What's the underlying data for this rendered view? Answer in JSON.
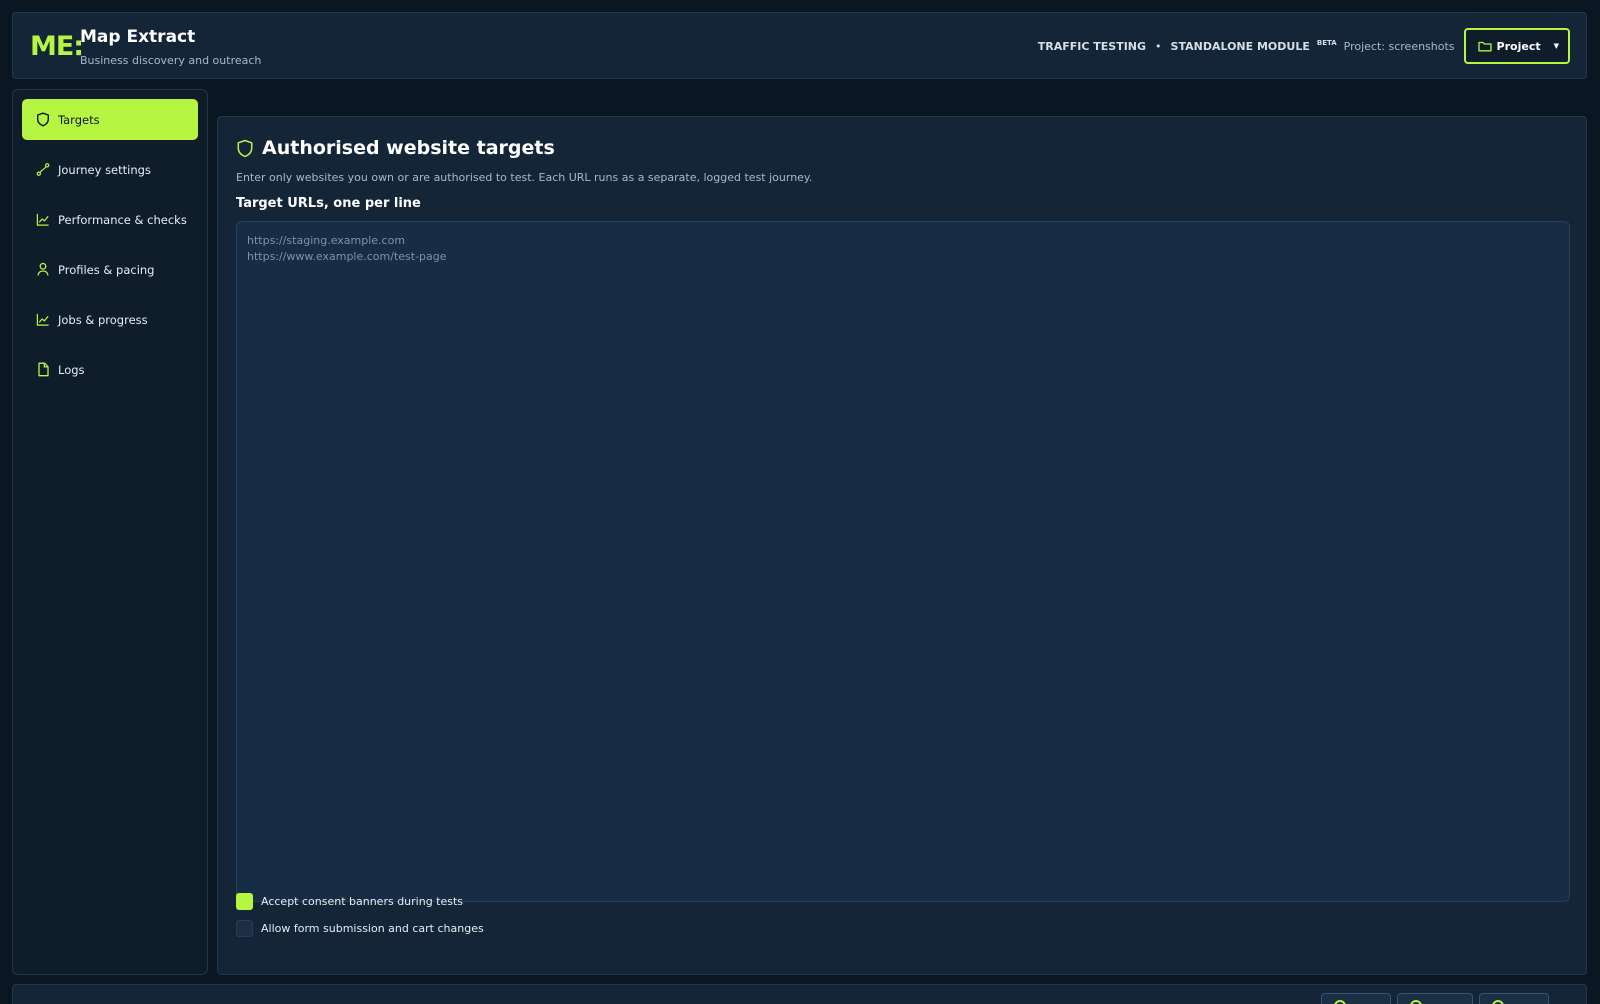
{
  "header": {
    "logo": "ME:",
    "title": "Map Extract",
    "subtitle": "Business discovery and outreach",
    "mode": "TRAFFIC TESTING",
    "separator": "•",
    "module": "STANDALONE MODULE",
    "beta": "BETA",
    "project_text": "Project: screenshots",
    "project_button": "Project"
  },
  "sidebar": {
    "items": [
      {
        "label": "Targets",
        "icon": "shield-icon",
        "active": true
      },
      {
        "label": "Journey settings",
        "icon": "route-icon"
      },
      {
        "label": "Performance & checks",
        "icon": "chart-line-icon"
      },
      {
        "label": "Profiles & pacing",
        "icon": "user-icon"
      },
      {
        "label": "Jobs & progress",
        "icon": "chart-line-icon"
      },
      {
        "label": "Logs",
        "icon": "file-icon"
      }
    ]
  },
  "main": {
    "title": "Authorised website targets",
    "description": "Enter only websites you own or are authorised to test. Each URL runs as a separate, logged test journey.",
    "field_label": "Target URLs, one per line",
    "urls_value": "",
    "urls_placeholder": "https://staging.example.com\nhttps://www.example.com/test-page",
    "options": [
      {
        "label": "Accept consent banners during tests",
        "checked": true
      },
      {
        "label": "Allow form submission and cart changes",
        "checked": false
      }
    ]
  },
  "colors": {
    "accent": "#b6f542",
    "background": "#0a1622",
    "panel": "#142538",
    "input": "#172c45"
  }
}
